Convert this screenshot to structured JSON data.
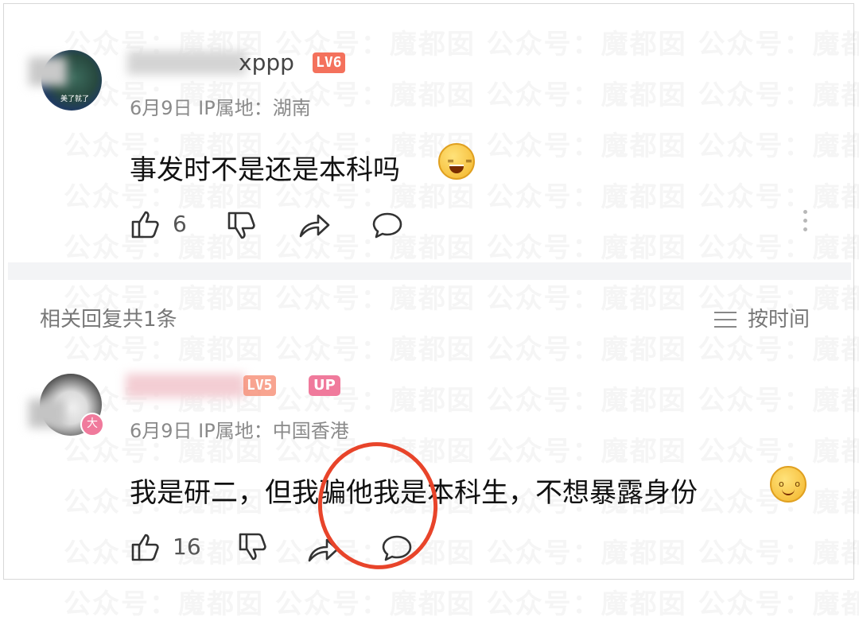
{
  "watermark": {
    "rows": [
      "公众号：魔都囡   公众号：魔都囡   公众号：魔都囡   公众号：魔都囡",
      "公众号：魔都囡   公众号：魔都囡   公众号：魔都囡   公众号：魔都囡",
      "公众号：魔都囡   公众号：魔都囡   公众号：魔都囡   公众号：魔都囡",
      "公众号：魔都囡   公众号：魔都囡   公众号：魔都囡   公众号：魔都囡",
      "公众号：魔都囡   公众号：魔都囡   公众号：魔都囡   公众号：魔都囡",
      "公众号：魔都囡   公众号：魔都囡   公众号：魔都囡   公众号：魔都囡",
      "公众号：魔都囡   公众号：魔都囡   公众号：魔都囡   公众号：魔都囡",
      "公众号：魔都囡   公众号：魔都囡   公众号：魔都囡   公众号：魔都囡",
      "公众号：魔都囡   公众号：魔都囡   公众号：魔都囡   公众号：魔都囡",
      "公众号：魔都囡   公众号：魔都囡   公众号：魔都囡   公众号：魔都囡",
      "公众号：魔都囡   公众号：魔都囡   公众号：魔都囡   公众号：魔都囡",
      "公众号：魔都囡   公众号：魔都囡   公众号：魔都囡   公众号：魔都囡"
    ]
  },
  "comment": {
    "avatar_tag": "美了就了",
    "username_visible": "xppp",
    "level": "LV6",
    "meta": "6月9日 IP属地：湖南",
    "text": "事发时不是还是本科吗",
    "likes": "6"
  },
  "related": {
    "label": "相关回复共1条",
    "sort_label": "按时间"
  },
  "reply": {
    "avatar_badge": "大",
    "level": "LV5",
    "up_badge": "UP",
    "meta": "6月9日 IP属地：中国香港",
    "text": "我是研二，但我骗他我是本科生，不想暴露身份",
    "likes": "16"
  },
  "colors": {
    "level_lv6": "#f4715c",
    "level_lv5": "#f6866c",
    "up_badge": "#f07a9c",
    "annotation_circle": "#e8442a"
  }
}
